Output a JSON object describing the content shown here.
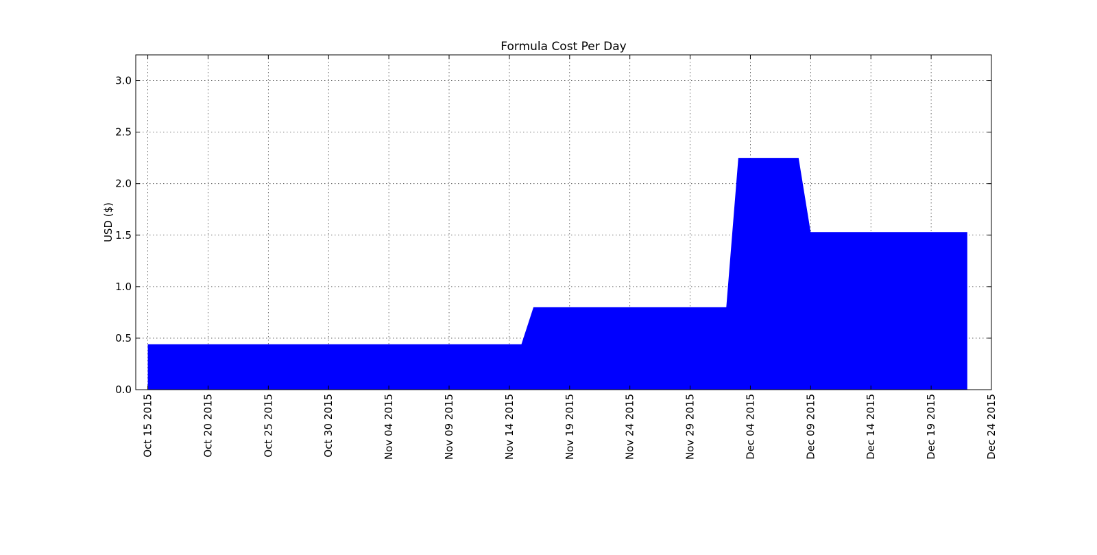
{
  "chart_data": {
    "type": "area",
    "title": "Formula Cost Per Day",
    "xlabel": "",
    "ylabel": "USD ($)",
    "grid": true,
    "colors": {
      "fill": "#0000ff"
    },
    "xlim": [
      "2015-10-14",
      "2015-12-24"
    ],
    "ylim": [
      0,
      3.25
    ],
    "x_ticks": [
      {
        "date": "2015-10-15",
        "label": "Oct 15 2015"
      },
      {
        "date": "2015-10-20",
        "label": "Oct 20 2015"
      },
      {
        "date": "2015-10-25",
        "label": "Oct 25 2015"
      },
      {
        "date": "2015-10-30",
        "label": "Oct 30 2015"
      },
      {
        "date": "2015-11-04",
        "label": "Nov 04 2015"
      },
      {
        "date": "2015-11-09",
        "label": "Nov 09 2015"
      },
      {
        "date": "2015-11-14",
        "label": "Nov 14 2015"
      },
      {
        "date": "2015-11-19",
        "label": "Nov 19 2015"
      },
      {
        "date": "2015-11-24",
        "label": "Nov 24 2015"
      },
      {
        "date": "2015-11-29",
        "label": "Nov 29 2015"
      },
      {
        "date": "2015-12-04",
        "label": "Dec 04 2015"
      },
      {
        "date": "2015-12-09",
        "label": "Dec 09 2015"
      },
      {
        "date": "2015-12-14",
        "label": "Dec 14 2015"
      },
      {
        "date": "2015-12-19",
        "label": "Dec 19 2015"
      },
      {
        "date": "2015-12-24",
        "label": "Dec 24 2015"
      }
    ],
    "y_ticks": [
      {
        "value": 0.0,
        "label": "0.0"
      },
      {
        "value": 0.5,
        "label": "0.5"
      },
      {
        "value": 1.0,
        "label": "1.0"
      },
      {
        "value": 1.5,
        "label": "1.5"
      },
      {
        "value": 2.0,
        "label": "2.0"
      },
      {
        "value": 2.5,
        "label": "2.5"
      },
      {
        "value": 3.0,
        "label": "3.0"
      }
    ],
    "series": [
      {
        "points": [
          {
            "x": "2015-10-15",
            "y": 0.44
          },
          {
            "x": "2015-11-15",
            "y": 0.44
          },
          {
            "x": "2015-11-16",
            "y": 0.8
          },
          {
            "x": "2015-12-02",
            "y": 0.8
          },
          {
            "x": "2015-12-03",
            "y": 2.25
          },
          {
            "x": "2015-12-08",
            "y": 2.25
          },
          {
            "x": "2015-12-09",
            "y": 1.53
          },
          {
            "x": "2015-12-22",
            "y": 1.53
          }
        ]
      }
    ]
  }
}
